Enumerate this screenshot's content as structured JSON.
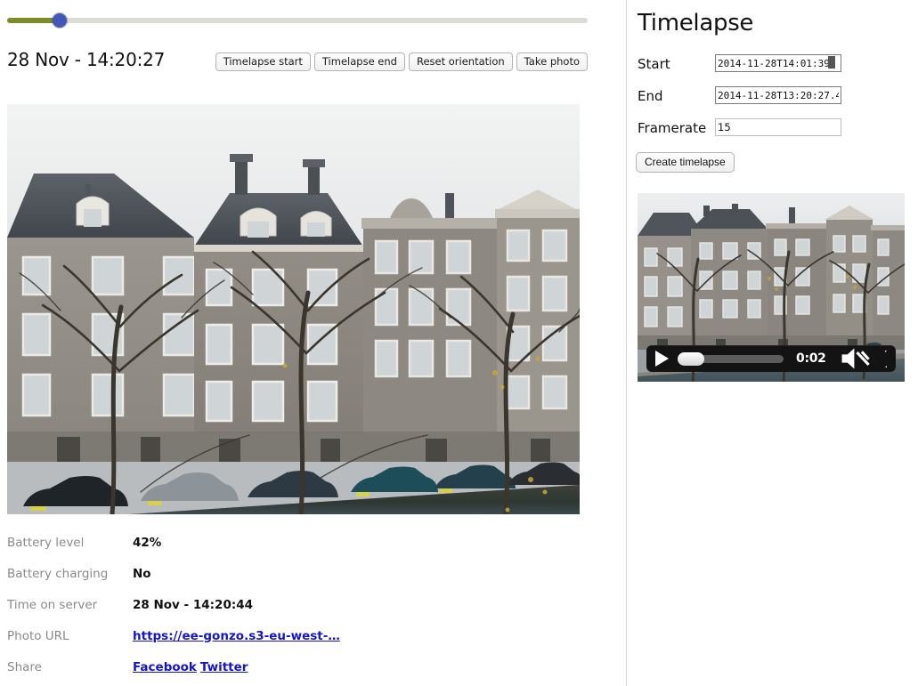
{
  "slider": {
    "name": "time-slider",
    "value_percent": 9,
    "fill_color": "#7d8c28",
    "thumb_color": "#4359b5"
  },
  "left": {
    "timestamp": "28 Nov - 14:20:27",
    "buttons": [
      {
        "label": "Timelapse start"
      },
      {
        "label": "Timelapse end"
      },
      {
        "label": "Reset orientation"
      },
      {
        "label": "Take photo"
      }
    ],
    "photo_alt": "Amsterdam canal houses with parked cars and bare trees",
    "info": [
      {
        "key": "Battery level",
        "value": "42%",
        "type": "text"
      },
      {
        "key": "Battery charging",
        "value": "No",
        "type": "text"
      },
      {
        "key": "Time on server",
        "value": "28 Nov - 14:20:44",
        "type": "text"
      },
      {
        "key": "Photo URL",
        "value": "https://ee-gonzo.s3-eu-west-…",
        "type": "link"
      },
      {
        "key": "Share",
        "value": "",
        "type": "share"
      }
    ],
    "share": {
      "facebook": "Facebook",
      "twitter": "Twitter",
      "link_color": "#1414c8"
    }
  },
  "right": {
    "title": "Timelapse",
    "fields": [
      {
        "label": "Start",
        "value": "2014-11-28T14:01:39.",
        "focused": true
      },
      {
        "label": "End",
        "value": "2014-11-28T13:20:27.4",
        "focused": true
      },
      {
        "label": "Framerate",
        "value": "15",
        "focused": false
      }
    ],
    "create_button": "Create timelapse",
    "video": {
      "alt": "Timelapse video preview of the canal",
      "time": "0:02",
      "muted": true,
      "play_label": "play",
      "fullscreen_label": "fullscreen"
    }
  }
}
